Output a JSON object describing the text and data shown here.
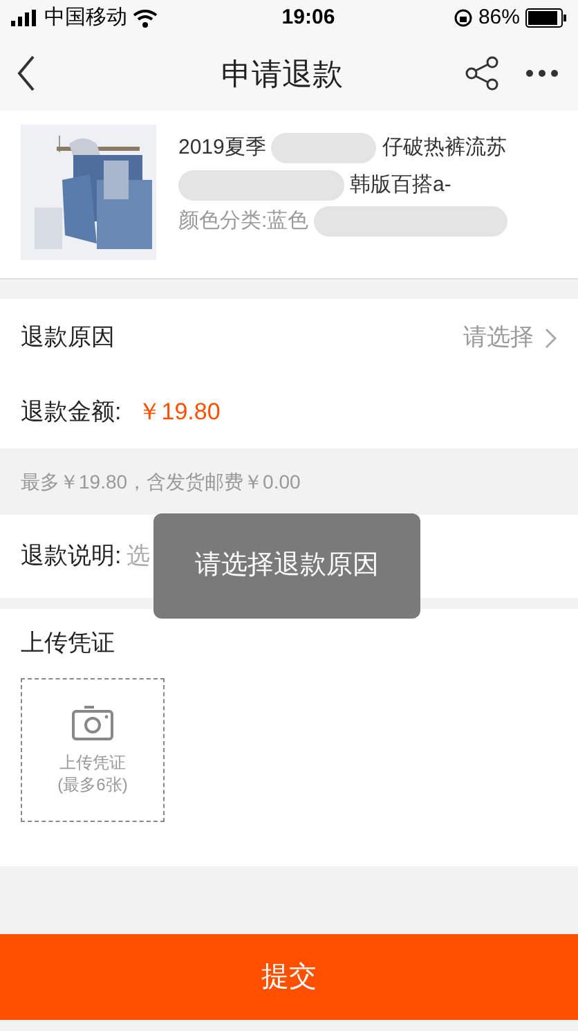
{
  "status_bar": {
    "carrier": "中国移动",
    "time": "19:06",
    "battery": "86%"
  },
  "nav": {
    "title": "申请退款"
  },
  "product": {
    "title_start": "2019夏季",
    "title_end": "仔破热裤流苏",
    "line2_end": "韩版百搭a-",
    "sku_start": "颜色分类:蓝色"
  },
  "reason": {
    "label": "退款原因",
    "value": "请选择"
  },
  "amount": {
    "label": "退款金额:",
    "value": "￥19.80"
  },
  "note": "最多￥19.80，含发货邮费￥0.00",
  "explanation": {
    "label": "退款说明:",
    "placeholder": "选"
  },
  "toast": "请选择退款原因",
  "upload": {
    "title": "上传凭证",
    "button_line1": "上传凭证",
    "button_line2": "(最多6张)"
  },
  "submit": "提交"
}
